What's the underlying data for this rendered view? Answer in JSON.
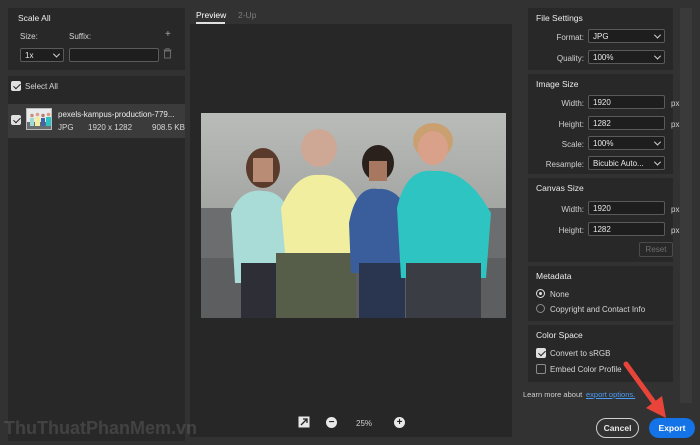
{
  "left": {
    "scale_all_title": "Scale All",
    "size_label": "Size:",
    "suffix_label": "Suffix:",
    "size_value": "1x",
    "suffix_value": "",
    "select_all_label": "Select All",
    "file": {
      "name": "pexels-kampus-production-779...",
      "format": "JPG",
      "dimensions": "1920 x 1282",
      "filesize": "908.5 KB"
    }
  },
  "center": {
    "tabs": [
      "Preview",
      "2-Up"
    ],
    "active_tab": "Preview",
    "zoom": "25%"
  },
  "file_settings": {
    "title": "File Settings",
    "format_label": "Format:",
    "format_value": "JPG",
    "quality_label": "Quality:",
    "quality_value": "100%"
  },
  "image_size": {
    "title": "Image Size",
    "width_label": "Width:",
    "width_value": "1920",
    "height_label": "Height:",
    "height_value": "1282",
    "scale_label": "Scale:",
    "scale_value": "100%",
    "resample_label": "Resample:",
    "resample_value": "Bicubic Auto...",
    "unit": "px"
  },
  "canvas_size": {
    "title": "Canvas Size",
    "width_label": "Width:",
    "width_value": "1920",
    "height_label": "Height:",
    "height_value": "1282",
    "unit": "px",
    "reset_label": "Reset"
  },
  "metadata": {
    "title": "Metadata",
    "options": [
      "None",
      "Copyright and Contact Info"
    ],
    "selected": "None"
  },
  "color_space": {
    "title": "Color Space",
    "convert_label": "Convert to sRGB",
    "convert_checked": true,
    "embed_label": "Embed Color Profile",
    "embed_checked": false
  },
  "footer": {
    "learn_more_text": "Learn more about",
    "learn_more_link": "export options.",
    "cancel_label": "Cancel",
    "export_label": "Export"
  },
  "watermark": "ThuThuatPhanMem.vn",
  "colors": {
    "accent": "#1473e6",
    "arrow": "#e8443a",
    "link": "#4b9cf5"
  }
}
